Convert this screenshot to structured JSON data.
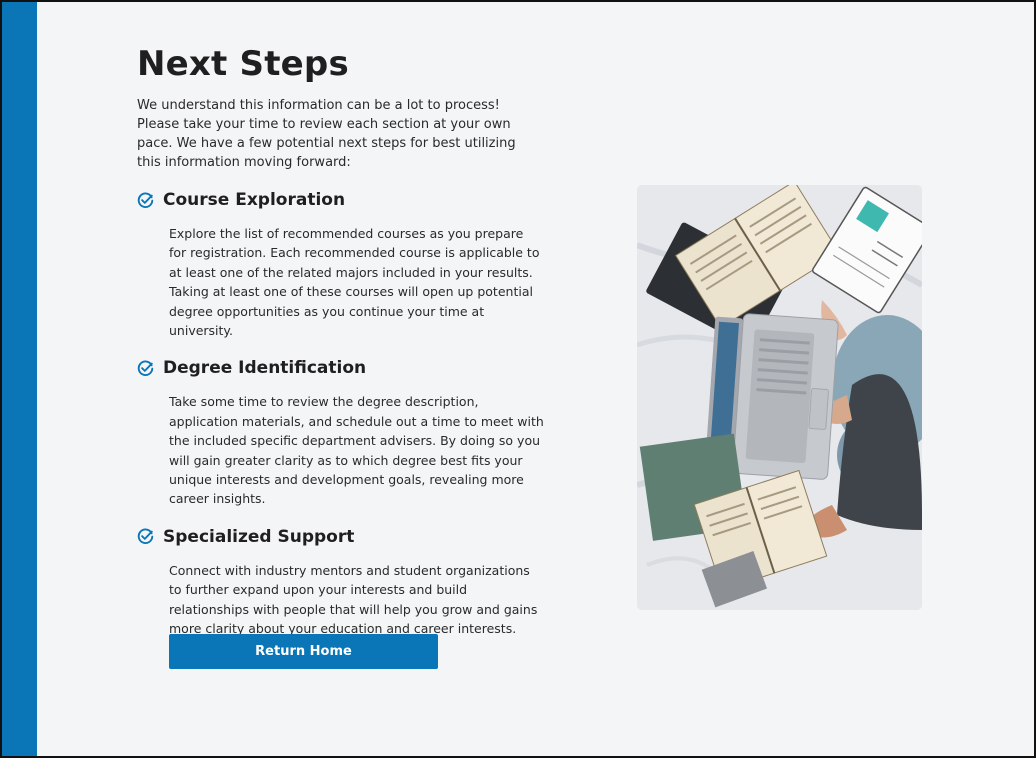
{
  "page": {
    "title": "Next Steps",
    "intro": "We understand this information can be a lot to process! Please take your time to review each section at your own pace. We have a few potential next steps for best utilizing this information moving forward:"
  },
  "steps": [
    {
      "icon": "check-circle-icon",
      "title": "Course Exploration",
      "description": "Explore the list of recommended courses as you prepare for registration. Each recommended course is applicable to at least one of the related majors included in your results. Taking at least one of these courses will open up potential degree opportunities as you continue your time at university."
    },
    {
      "icon": "check-circle-icon",
      "title": "Degree Identification",
      "description": "Take some time to review the degree description, application materials, and schedule out a time to meet with the included specific department advisers. By doing so you will gain greater clarity as to which degree best fits your unique interests and development goals, revealing more career insights."
    },
    {
      "icon": "check-circle-icon",
      "title": "Specialized Support",
      "description": "Connect with industry mentors and student organizations to further expand upon your interests and build relationships with people that will help you grow and gains more clarity about your education and career interests."
    }
  ],
  "actions": {
    "return_home_label": "Return Home"
  },
  "colors": {
    "accent": "#0a76b7",
    "background": "#f4f5f7",
    "text": "#1f1f1f"
  }
}
